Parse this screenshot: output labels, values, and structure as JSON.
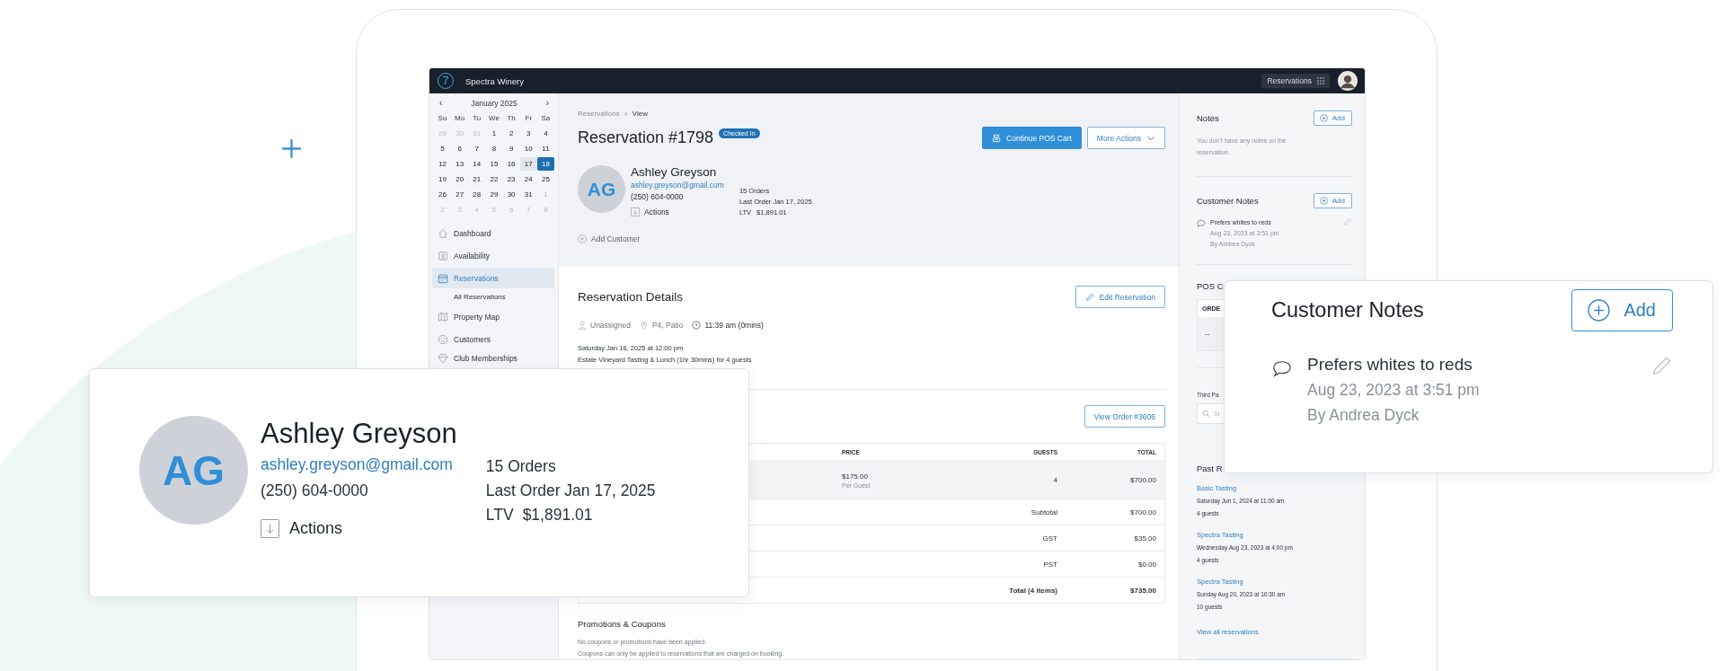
{
  "app": {
    "logo": "7",
    "name": "Spectra Winery",
    "top_chip": "Reservations"
  },
  "calendar": {
    "prev": "‹",
    "next": "›",
    "month": "January 2025",
    "weekdays": [
      "Su",
      "Mo",
      "Tu",
      "We",
      "Th",
      "Fr",
      "Sa"
    ],
    "days": [
      {
        "day": "29",
        "outside": true,
        "selected": false,
        "highlighted": false
      },
      {
        "day": "30",
        "outside": true,
        "selected": false,
        "highlighted": false
      },
      {
        "day": "31",
        "outside": true,
        "selected": false,
        "highlighted": false
      },
      {
        "day": "1",
        "outside": false,
        "selected": false,
        "highlighted": false
      },
      {
        "day": "2",
        "outside": false,
        "selected": false,
        "highlighted": false
      },
      {
        "day": "3",
        "outside": false,
        "selected": false,
        "highlighted": false
      },
      {
        "day": "4",
        "outside": false,
        "selected": false,
        "highlighted": false
      },
      {
        "day": "5",
        "outside": false,
        "selected": false,
        "highlighted": false
      },
      {
        "day": "6",
        "outside": false,
        "selected": false,
        "highlighted": false
      },
      {
        "day": "7",
        "outside": false,
        "selected": false,
        "highlighted": false
      },
      {
        "day": "8",
        "outside": false,
        "selected": false,
        "highlighted": false
      },
      {
        "day": "9",
        "outside": false,
        "selected": false,
        "highlighted": false
      },
      {
        "day": "10",
        "outside": false,
        "selected": false,
        "highlighted": false
      },
      {
        "day": "11",
        "outside": false,
        "selected": false,
        "highlighted": false
      },
      {
        "day": "12",
        "outside": false,
        "selected": false,
        "highlighted": false
      },
      {
        "day": "13",
        "outside": false,
        "selected": false,
        "highlighted": false
      },
      {
        "day": "14",
        "outside": false,
        "selected": false,
        "highlighted": false
      },
      {
        "day": "15",
        "outside": false,
        "selected": false,
        "highlighted": false
      },
      {
        "day": "16",
        "outside": false,
        "selected": false,
        "highlighted": false
      },
      {
        "day": "17",
        "outside": false,
        "selected": false,
        "highlighted": true
      },
      {
        "day": "18",
        "outside": false,
        "selected": true,
        "highlighted": false
      },
      {
        "day": "19",
        "outside": false,
        "selected": false,
        "highlighted": false
      },
      {
        "day": "20",
        "outside": false,
        "selected": false,
        "highlighted": false
      },
      {
        "day": "21",
        "outside": false,
        "selected": false,
        "highlighted": false
      },
      {
        "day": "22",
        "outside": false,
        "selected": false,
        "highlighted": false
      },
      {
        "day": "23",
        "outside": false,
        "selected": false,
        "highlighted": false
      },
      {
        "day": "24",
        "outside": false,
        "selected": false,
        "highlighted": false
      },
      {
        "day": "25",
        "outside": false,
        "selected": false,
        "highlighted": false
      },
      {
        "day": "26",
        "outside": false,
        "selected": false,
        "highlighted": false
      },
      {
        "day": "27",
        "outside": false,
        "selected": false,
        "highlighted": false
      },
      {
        "day": "28",
        "outside": false,
        "selected": false,
        "highlighted": false
      },
      {
        "day": "29",
        "outside": false,
        "selected": false,
        "highlighted": false
      },
      {
        "day": "30",
        "outside": false,
        "selected": false,
        "highlighted": false
      },
      {
        "day": "31",
        "outside": false,
        "selected": false,
        "highlighted": false
      },
      {
        "day": "1",
        "outside": true,
        "selected": false,
        "highlighted": false
      },
      {
        "day": "2",
        "outside": true,
        "selected": false,
        "highlighted": false
      },
      {
        "day": "3",
        "outside": true,
        "selected": false,
        "highlighted": false
      },
      {
        "day": "4",
        "outside": true,
        "selected": false,
        "highlighted": false
      },
      {
        "day": "5",
        "outside": true,
        "selected": false,
        "highlighted": false
      },
      {
        "day": "6",
        "outside": true,
        "selected": false,
        "highlighted": false
      },
      {
        "day": "7",
        "outside": true,
        "selected": false,
        "highlighted": false
      },
      {
        "day": "8",
        "outside": true,
        "selected": false,
        "highlighted": false
      }
    ]
  },
  "nav": [
    {
      "label": "Dashboard",
      "selected": false
    },
    {
      "label": "Availability",
      "selected": false
    },
    {
      "label": "Reservations",
      "selected": true,
      "children": [
        {
          "label": "All Reservations",
          "selected": false
        }
      ]
    },
    {
      "label": "Property Map",
      "selected": false
    },
    {
      "label": "Customers",
      "selected": false
    },
    {
      "label": "Club Memberships",
      "selected": false
    }
  ],
  "breadcrumb": {
    "items": [
      "Reservations",
      "View"
    ],
    "separator": ">"
  },
  "reservation": {
    "title": "Reservation #1798",
    "status": "Checked In",
    "primary_button": "Continue POS Cart",
    "secondary_button": "More Actions"
  },
  "customer": {
    "initials": "AG",
    "name": "Ashley Greyson",
    "email": "ashley.greyson@gmail.com",
    "phone": "(250) 604-0000",
    "actions": "Actions",
    "orders": "15 Orders",
    "last_order": "Last Order Jan 17, 2025",
    "ltv_label": "LTV",
    "ltv_value": "$1,891.01",
    "add_customer": "Add Customer"
  },
  "details": {
    "title": "Reservation Details",
    "edit_button": "Edit Reservation",
    "assignee": "Unassigned",
    "location": "P4, Patio",
    "time": "11:39 am (0mins)",
    "datetime": "Saturday Jan 18, 2025 at 12:00 pm",
    "experience": "Estate Vineyard Tasting & Lunch (1hr 30mins) for 4 guests"
  },
  "order": {
    "view_button": "View Order #3606",
    "columns": [
      "PRICE",
      "GUESTS",
      "TOTAL"
    ],
    "items": [
      {
        "price": "$175.00",
        "price_note": "Per Guest",
        "guests": "4",
        "total": "$700.00"
      }
    ],
    "summary": [
      {
        "label": "Subtotal",
        "value": "$700.00",
        "kind": "line"
      },
      {
        "label": "GST",
        "value": "$35.00",
        "kind": "line"
      },
      {
        "label": "PST",
        "value": "$0.00",
        "kind": "line"
      },
      {
        "label": "Total (4 items)",
        "value": "$735.00",
        "kind": "total"
      }
    ]
  },
  "promotions": {
    "title": "Promotions & Coupons",
    "lines": [
      "No coupons or promotions have been applied.",
      "Coupons can only be applied to reservations that are charged on booking."
    ]
  },
  "notes": {
    "title": "Notes",
    "add": "Add",
    "empty": "You don’t have any notes on the reservation."
  },
  "customer_notes": {
    "title": "Customer Notes",
    "add": "Add",
    "items": [
      {
        "text": "Prefers whites to reds",
        "date": "Aug 23, 2023 at 3:51 pm",
        "author": "By Andrea Dyck"
      }
    ]
  },
  "pos": {
    "title": "POS C",
    "column": "ORDE",
    "cell": "--"
  },
  "third_party": {
    "label": "Third Pa",
    "placeholder": "St"
  },
  "past": {
    "title": "Past R",
    "items": [
      {
        "name": "Basic Tasting",
        "date": "Saturday Jun 1, 2024 at 11:00 am",
        "guests": "4 guests"
      },
      {
        "name": "Spectra Tasting",
        "date": "Wednesday Aug 23, 2023 at 4:00 pm",
        "guests": "4 guests"
      },
      {
        "name": "Spectra Tasting",
        "date": "Sunday Aug 20, 2023 at 10:30 am",
        "guests": "10 guests"
      }
    ],
    "view_all": "View all reservations"
  },
  "zoom_customer": {
    "initials": "AG",
    "name": "Ashley Greyson",
    "email": "ashley.greyson@gmail.com",
    "phone": "(250) 604-0000",
    "actions": "Actions",
    "orders": "15 Orders",
    "last_order": "Last Order Jan 17, 2025",
    "ltv_label": "LTV",
    "ltv_value": "$1,891.01"
  },
  "zoom_notes": {
    "title": "Customer Notes",
    "add": "Add",
    "items": [
      {
        "text": "Prefers whites to reds",
        "date": "Aug 23, 2023 at 3:51 pm",
        "author": "By Andrea Dyck"
      }
    ]
  }
}
